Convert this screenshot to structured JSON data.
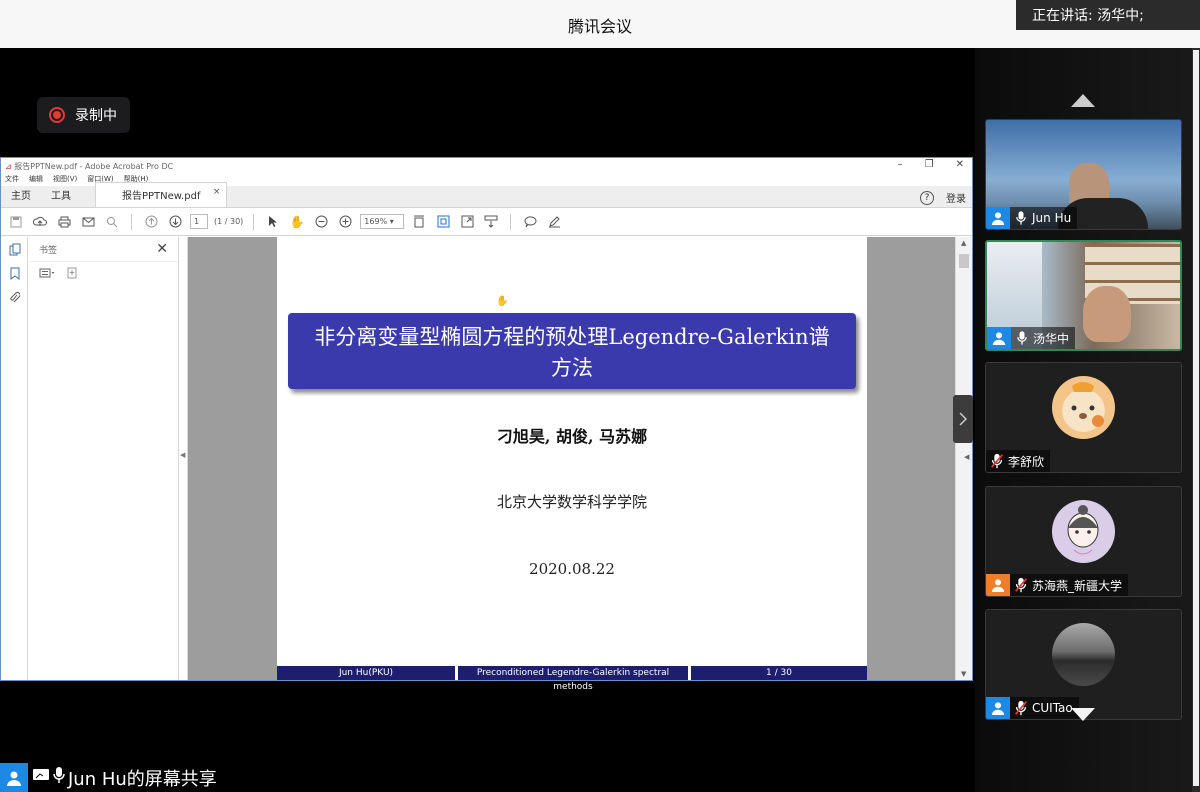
{
  "app": {
    "title": "腾讯会议",
    "speaking": "正在讲话: 汤华中;"
  },
  "recording": {
    "label": "录制中"
  },
  "acrobat": {
    "window_title": "报告PPTNew.pdf - Adobe Acrobat Pro DC",
    "menu": [
      "文件",
      "编辑",
      "视图(V)",
      "窗口(W)",
      "帮助(H)"
    ],
    "tabs": {
      "home": "主页",
      "tools": "工具",
      "doc": "报告PPTNew.pdf"
    },
    "login": "登录",
    "page_current": "1",
    "page_total": "(1 / 30)",
    "zoom": "169%",
    "bookmarks_title": "书签"
  },
  "slide": {
    "title": "非分离变量型椭圆方程的预处理Legendre-Galerkin谱方法",
    "authors": "刁旭昊, 胡俊, 马苏娜",
    "institution": "北京大学数学科学学院",
    "date": "2020.08.22",
    "footer": {
      "left": "Jun Hu(PKU)",
      "center": "Preconditioned Legendre-Galerkin spectral methods",
      "right": "1 / 30"
    }
  },
  "share": {
    "label": "Jun Hu的屏幕共享"
  },
  "participants": [
    {
      "name": "Jun Hu",
      "mic": "on"
    },
    {
      "name": "汤华中",
      "mic": "on"
    },
    {
      "name": "李舒欣",
      "mic": "muted"
    },
    {
      "name": "苏海燕_新疆大学",
      "mic": "muted"
    },
    {
      "name": "CUITao",
      "mic": "muted"
    }
  ],
  "colors": {
    "accent": "#1e88e5",
    "slide_title_bg": "#3a3aad",
    "record": "#e53935",
    "active_border": "#2e8b57"
  }
}
